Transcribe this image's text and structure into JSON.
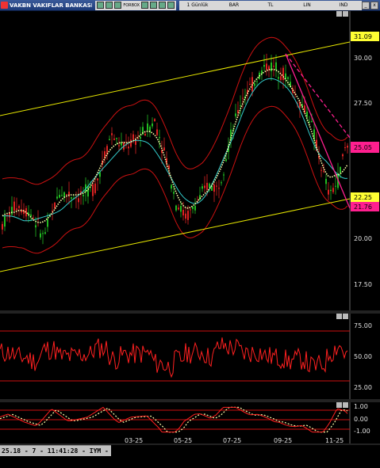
{
  "window": {
    "title": "VAKBN VAKIFLAR BANKASI - 1 Günlük",
    "toolbar": {
      "forbox_label": "FORBOX",
      "menu": [
        "1 Günlük",
        "BAR",
        "TL",
        "LIN",
        "IND"
      ]
    }
  },
  "price_axis": {
    "ticks": [
      "31.09",
      "30.00",
      "27.50",
      "25.05",
      "22.25",
      "21.76",
      "20.00",
      "17.50"
    ],
    "highlight_colors": {
      "yellow": "#ffff33",
      "magenta": "#ff1f8f"
    }
  },
  "rsi_axis": {
    "ticks": [
      "75.00",
      "50.00",
      "25.00"
    ]
  },
  "macd_axis": {
    "ticks": [
      "1.00",
      "0.00",
      "-1.00"
    ]
  },
  "date_axis": {
    "ticks": [
      "03-25",
      "05-25",
      "07-25",
      "09-25",
      "11-25"
    ]
  },
  "status": {
    "text": "25.18 - 7 - 11:41:28 - IYM - TBY"
  },
  "colors": {
    "background": "#000000",
    "channel": "#e6e600",
    "bollinger": "#cc1111",
    "ma_cyan": "#33cccc",
    "ma_dotted": "#ffffaa",
    "trend_magenta": "#ff1f8f",
    "candle_up": "#22bb22",
    "candle_down": "#dd2222",
    "indicator_line": "#ff2020",
    "axis_text": "#e0e0e0"
  },
  "chart_data": {
    "type": "line",
    "symbol": "VAKBN",
    "x": [
      "03-25",
      "05-25",
      "07-25",
      "09-25",
      "11-25"
    ],
    "price_levels_marked": [
      31.09,
      30.0,
      27.5,
      25.05,
      22.25,
      21.76,
      20.0,
      17.5
    ],
    "last_price": 25.05,
    "rsi_levels": [
      75,
      50,
      25
    ],
    "macd_levels": [
      1.0,
      0.0,
      -1.0
    ]
  }
}
